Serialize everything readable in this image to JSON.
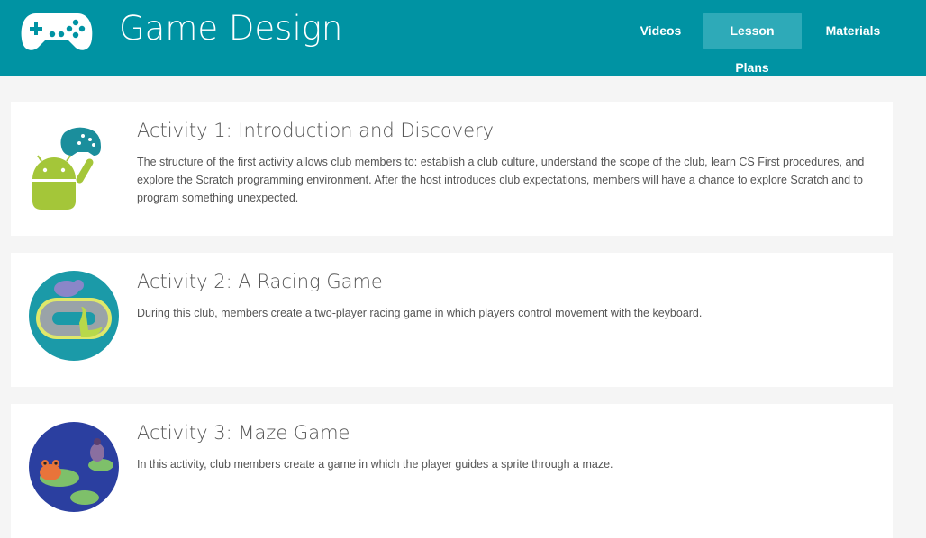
{
  "header": {
    "title": "Game Design",
    "logo_icon": "gamepad-icon",
    "background": "#0093a3"
  },
  "nav": {
    "items": [
      {
        "label": "Videos",
        "active": false
      },
      {
        "label": "Lesson Plans",
        "active": true
      },
      {
        "label": "Materials",
        "active": false
      }
    ]
  },
  "activities": [
    {
      "title": "Activity 1: Introduction and Discovery",
      "description": "The structure of the first activity allows club members to: establish a club culture, understand the scope of the club, learn CS First procedures, and explore the Scratch programming environment. After the host introduces club expectations, members will have a chance to explore Scratch and to program something unexpected.",
      "image_icon": "android-gamepad-icon"
    },
    {
      "title": "Activity 2: A Racing Game",
      "description": "During this club, members create a two-player racing game in which players control movement with the keyboard.",
      "image_icon": "racetrack-icon"
    },
    {
      "title": "Activity 3: Maze Game",
      "description": "In this activity, club members create a game in which the player guides a sprite through a maze.",
      "image_icon": "pond-maze-icon"
    }
  ]
}
